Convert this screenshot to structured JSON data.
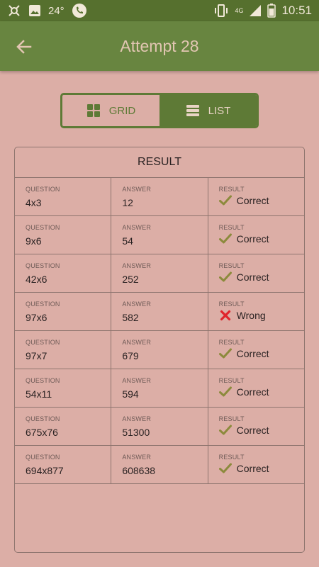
{
  "status_bar": {
    "temperature": "24°",
    "network": "4G",
    "time": "10:51"
  },
  "app_bar": {
    "title": "Attempt 28"
  },
  "view_toggle": {
    "grid_label": "GRID",
    "list_label": "LIST",
    "selected": "LIST"
  },
  "result": {
    "header": "RESULT",
    "question_label": "QUESTION",
    "answer_label": "ANSWER",
    "result_label": "RESULT",
    "rows": [
      {
        "question": "4x3",
        "answer": "12",
        "result": "Correct",
        "status": "correct"
      },
      {
        "question": "9x6",
        "answer": "54",
        "result": "Correct",
        "status": "correct"
      },
      {
        "question": "42x6",
        "answer": "252",
        "result": "Correct",
        "status": "correct"
      },
      {
        "question": "97x6",
        "answer": "582",
        "result": "Wrong",
        "status": "wrong"
      },
      {
        "question": "97x7",
        "answer": "679",
        "result": "Correct",
        "status": "correct"
      },
      {
        "question": "54x11",
        "answer": "594",
        "result": "Correct",
        "status": "correct"
      },
      {
        "question": "675x76",
        "answer": "51300",
        "result": "Correct",
        "status": "correct"
      },
      {
        "question": "694x877",
        "answer": "608638",
        "result": "Correct",
        "status": "correct"
      }
    ]
  },
  "colors": {
    "primary": "#688540",
    "primary_dark": "#56702e",
    "background": "#dcaea6",
    "correct": "#8c8a3c",
    "wrong": "#e0252c"
  }
}
